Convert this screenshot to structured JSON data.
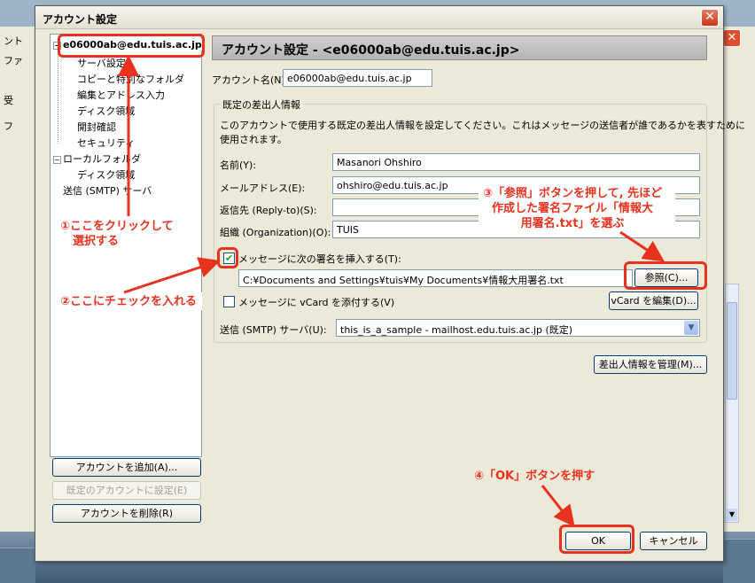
{
  "dialog": {
    "title": "アカウント設定",
    "close_label": "✕"
  },
  "tree": {
    "account": "e06000ab@edu.tuis.ac.jp",
    "account_children": [
      "サーバ設定",
      "コピーと特別なフォルダ",
      "編集とアドレス入力",
      "ディスク領域",
      "開封確認",
      "セキュリティ"
    ],
    "local_folder": "ローカルフォルダ",
    "local_children": [
      "ディスク領域"
    ],
    "smtp": "送信 (SMTP) サーバ"
  },
  "side_buttons": {
    "add": "アカウントを追加(A)...",
    "set_default": "既定のアカウントに設定(E)",
    "delete": "アカウントを削除(R)"
  },
  "panel": {
    "header": "アカウント設定 - <e06000ab@edu.tuis.ac.jp>",
    "account_name_label": "アカウント名(N):",
    "account_name_value": "e06000ab@edu.tuis.ac.jp",
    "identity_group": "既定の差出人情報",
    "identity_desc_1": "このアカウントで使用する既定の差出人情報を設定してください。これはメッセージの送信者が誰であるかを表すために",
    "identity_desc_2": "使用されます。",
    "name_label": "名前(Y):",
    "name_value": "Masanori Ohshiro",
    "email_label": "メールアドレス(E):",
    "email_value": "ohshiro@edu.tuis.ac.jp",
    "replyto_label": "返信先 (Reply-to)(S):",
    "replyto_value": "",
    "org_label": "組織 (Organization)(O):",
    "org_value": "TUIS",
    "signature_check_label": "メッセージに次の署名を挿入する(T):",
    "signature_checked": true,
    "signature_path": "C:¥Documents and Settings¥tuis¥My Documents¥情報大用署名.txt",
    "browse_button": "参照(C)...",
    "vcard_check_label": "メッセージに vCard を添付する(V)",
    "vcard_checked": false,
    "vcard_edit_button": "vCard を編集(D)...",
    "smtp_label": "送信 (SMTP) サーバ(U):",
    "smtp_value": "this_is_a_sample - mailhost.edu.tuis.ac.jp (既定)",
    "manage_identities_button": "差出人情報を管理(M)..."
  },
  "footer": {
    "ok": "OK",
    "cancel": "キャンセル"
  },
  "annotations": {
    "step1_line1": "①ここをクリックして",
    "step1_line2": "選択する",
    "step2": "②ここにチェックを入れる",
    "step3_line1": "③「参照」ボタンを押して, 先ほど",
    "step3_line2": "作成した署名ファイル「情報大",
    "step3_line3": "用署名.txt」を選ぶ",
    "step4": "④「OK」ボタンを押す",
    "color": "#e8321e"
  }
}
